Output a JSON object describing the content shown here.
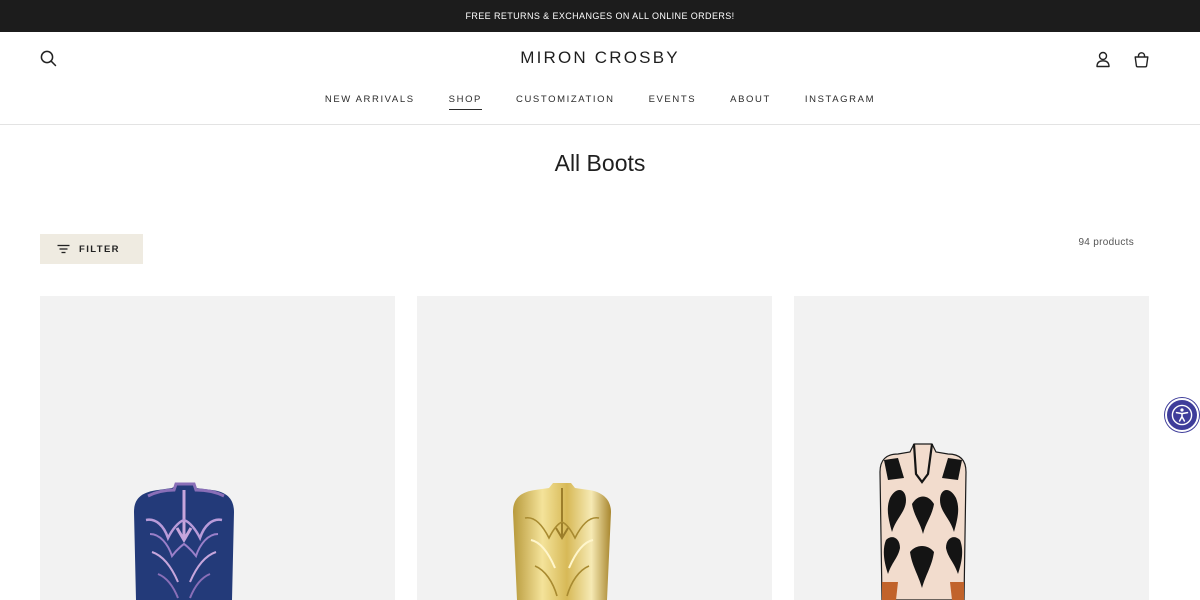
{
  "announcement": "FREE RETURNS & EXCHANGES ON ALL ONLINE ORDERS!",
  "header": {
    "logo": "MIRON CROSBY",
    "icons": {
      "search": "search-icon",
      "account": "user-icon",
      "cart": "bag-icon"
    }
  },
  "nav": {
    "items": [
      {
        "label": "NEW ARRIVALS",
        "active": false
      },
      {
        "label": "SHOP",
        "active": true
      },
      {
        "label": "CUSTOMIZATION",
        "active": false
      },
      {
        "label": "EVENTS",
        "active": false
      },
      {
        "label": "ABOUT",
        "active": false
      },
      {
        "label": "INSTAGRAM",
        "active": false
      }
    ]
  },
  "page": {
    "title": "All Boots"
  },
  "toolbar": {
    "filter_label": "FILTER",
    "product_count": "94 products"
  },
  "products": [
    {
      "image": "blue-purple-cowboy-boot",
      "color": "#2a3f7a"
    },
    {
      "image": "gold-metallic-cowboy-boot",
      "color": "#d9c06a"
    },
    {
      "image": "cream-black-tulip-cowboy-boot",
      "color": "#f1d9c9"
    }
  ],
  "accessibility": {
    "icon": "accessibility-icon",
    "color": "#3e3d9a"
  },
  "colors": {
    "announcement_bg": "#1c1c1c",
    "filter_bg": "#efebe1",
    "card_bg": "#f2f2f2"
  }
}
